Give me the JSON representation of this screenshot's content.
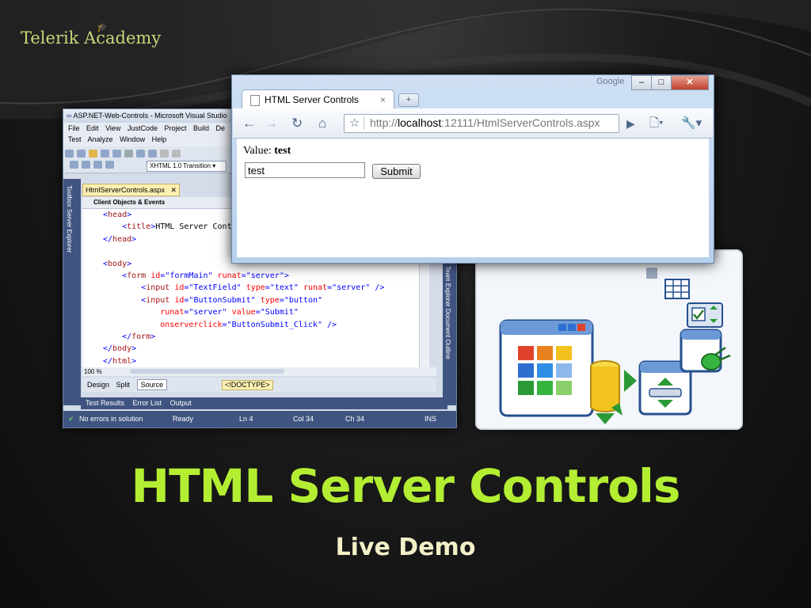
{
  "logo": {
    "text": "Telerik Academy"
  },
  "vs": {
    "title": "ASP.NET-Web-Controls - Microsoft Visual Studio",
    "menu_row1": [
      "File",
      "Edit",
      "View",
      "JustCode",
      "Project",
      "Build",
      "De"
    ],
    "menu_row2": [
      "Test",
      "Analyze",
      "Window",
      "Help"
    ],
    "doc_type_select": "XHTML 1.0 Transition",
    "toolbox_label": "Toolbox",
    "server_explorer_label": "Server Explorer",
    "right_panel_label": "Team Explorer",
    "document_outline_label": "Document Outline",
    "doc_tab": "HtmlServerControls.aspx",
    "nav_dropdown": "Client Objects & Events",
    "zoom": "100 %",
    "modes": {
      "design": "Design",
      "split": "Split",
      "source": "Source"
    },
    "doctype_tag": "<!DOCTYPE>",
    "bottom_tabs": [
      "Test Results",
      "Error List",
      "Output"
    ],
    "status": {
      "errors": "No errors in solution",
      "state": "Ready",
      "ln": "Ln 4",
      "col": "Col 34",
      "ch": "Ch 34",
      "ins": "INS"
    }
  },
  "browser": {
    "search_brand": "Google",
    "tab_title": "HTML Server Controls",
    "url_prefix": "http://",
    "url_host": "localhost",
    "url_rest": ":12111/HtmlServerControls.aspx",
    "value_label": "Value:",
    "value_text": "test",
    "textfield_value": "test",
    "submit_label": "Submit"
  },
  "slide": {
    "title": "HTML Server Controls",
    "subtitle": "Live Demo"
  },
  "colors": {
    "title": "#b3ee33",
    "subtitle": "#f3f0c8",
    "logo": "#c4d87a"
  }
}
